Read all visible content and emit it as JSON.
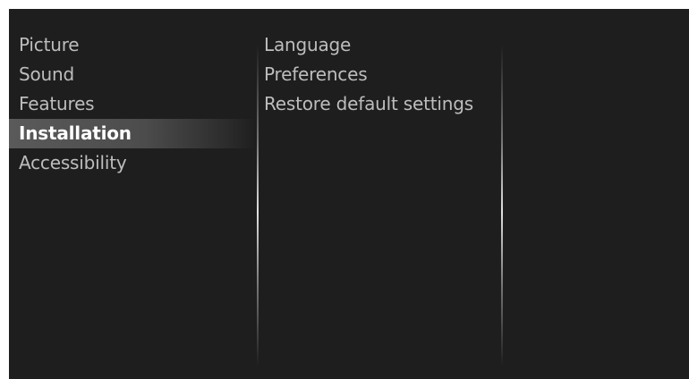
{
  "menu": {
    "main": [
      {
        "label": "Picture",
        "selected": false
      },
      {
        "label": "Sound",
        "selected": false
      },
      {
        "label": "Features",
        "selected": false
      },
      {
        "label": "Installation",
        "selected": true
      },
      {
        "label": "Accessibility",
        "selected": false
      }
    ],
    "submenu": [
      {
        "label": "Language"
      },
      {
        "label": "Preferences"
      },
      {
        "label": "Restore default settings"
      }
    ]
  },
  "colors": {
    "background": "#1e1e1e",
    "text": "#bdbdbd",
    "selected_text": "#ffffff",
    "selected_highlight": "#5a5a5a"
  }
}
